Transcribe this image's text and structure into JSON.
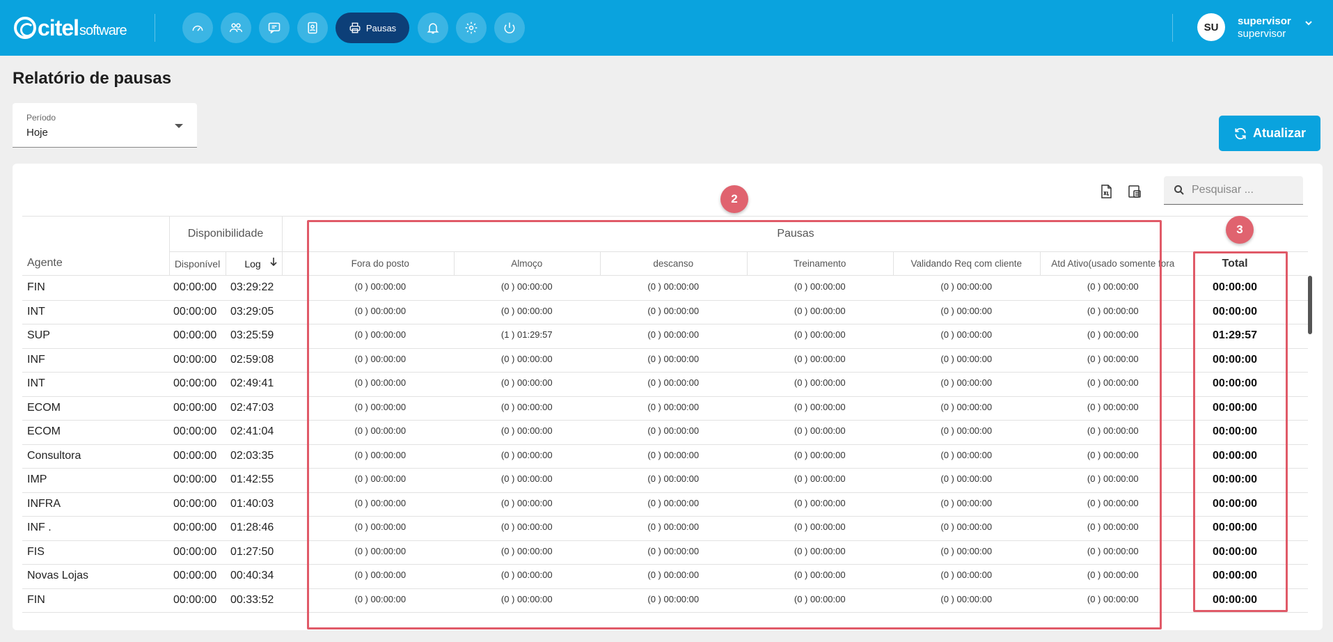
{
  "brand": {
    "name": "citel",
    "suffix": "software"
  },
  "nav": {
    "items": [
      {
        "icon": "dashboard-icon"
      },
      {
        "icon": "users-icon"
      },
      {
        "icon": "chat-icon"
      },
      {
        "icon": "contacts-icon"
      },
      {
        "icon": "printer-icon",
        "label": "Pausas",
        "active": true
      },
      {
        "icon": "bell-icon"
      },
      {
        "icon": "gear-icon"
      },
      {
        "icon": "power-icon"
      }
    ]
  },
  "user": {
    "initials": "SU",
    "name": "supervisor",
    "role": "supervisor"
  },
  "page": {
    "title": "Relatório de pausas"
  },
  "periodo": {
    "label": "Período",
    "value": "Hoje"
  },
  "refresh_label": "Atualizar",
  "search": {
    "placeholder": "Pesquisar ..."
  },
  "table": {
    "group_disponibilidade": "Disponibilidade",
    "group_pausas": "Pausas",
    "col_agente": "Agente",
    "col_disponivel": "Disponível",
    "col_log": "Log",
    "col_total": "Total",
    "pausa_columns": [
      "Fora do posto",
      "Almoço",
      "descanso",
      "Treinamento",
      "Validando Req com cliente",
      "Atd Ativo(usado somente fora"
    ],
    "rows": [
      {
        "agente": "FIN",
        "disponivel": "00:00:00",
        "log": "03:29:22",
        "pausas": [
          "(0 ) 00:00:00",
          "(0 ) 00:00:00",
          "(0 ) 00:00:00",
          "(0 ) 00:00:00",
          "(0 ) 00:00:00",
          "(0 ) 00:00:00"
        ],
        "total": "00:00:00"
      },
      {
        "agente": "INT",
        "disponivel": "00:00:00",
        "log": "03:29:05",
        "pausas": [
          "(0 ) 00:00:00",
          "(0 ) 00:00:00",
          "(0 ) 00:00:00",
          "(0 ) 00:00:00",
          "(0 ) 00:00:00",
          "(0 ) 00:00:00"
        ],
        "total": "00:00:00"
      },
      {
        "agente": "SUP",
        "disponivel": "00:00:00",
        "log": "03:25:59",
        "pausas": [
          "(0 ) 00:00:00",
          "(1 ) 01:29:57",
          "(0 ) 00:00:00",
          "(0 ) 00:00:00",
          "(0 ) 00:00:00",
          "(0 ) 00:00:00"
        ],
        "total": "01:29:57"
      },
      {
        "agente": "INF",
        "disponivel": "00:00:00",
        "log": "02:59:08",
        "pausas": [
          "(0 ) 00:00:00",
          "(0 ) 00:00:00",
          "(0 ) 00:00:00",
          "(0 ) 00:00:00",
          "(0 ) 00:00:00",
          "(0 ) 00:00:00"
        ],
        "total": "00:00:00"
      },
      {
        "agente": "INT",
        "disponivel": "00:00:00",
        "log": "02:49:41",
        "pausas": [
          "(0 ) 00:00:00",
          "(0 ) 00:00:00",
          "(0 ) 00:00:00",
          "(0 ) 00:00:00",
          "(0 ) 00:00:00",
          "(0 ) 00:00:00"
        ],
        "total": "00:00:00"
      },
      {
        "agente": " ECOM",
        "disponivel": "00:00:00",
        "log": "02:47:03",
        "pausas": [
          "(0 ) 00:00:00",
          "(0 ) 00:00:00",
          "(0 ) 00:00:00",
          "(0 ) 00:00:00",
          "(0 ) 00:00:00",
          "(0 ) 00:00:00"
        ],
        "total": "00:00:00"
      },
      {
        "agente": "ECOM",
        "disponivel": "00:00:00",
        "log": "02:41:04",
        "pausas": [
          "(0 ) 00:00:00",
          "(0 ) 00:00:00",
          "(0 ) 00:00:00",
          "(0 ) 00:00:00",
          "(0 ) 00:00:00",
          "(0 ) 00:00:00"
        ],
        "total": "00:00:00"
      },
      {
        "agente": "Consultora",
        "disponivel": "00:00:00",
        "log": "02:03:35",
        "pausas": [
          "(0 ) 00:00:00",
          "(0 ) 00:00:00",
          "(0 ) 00:00:00",
          "(0 ) 00:00:00",
          "(0 ) 00:00:00",
          "(0 ) 00:00:00"
        ],
        "total": "00:00:00"
      },
      {
        "agente": "IMP",
        "disponivel": "00:00:00",
        "log": "01:42:55",
        "pausas": [
          "(0 ) 00:00:00",
          "(0 ) 00:00:00",
          "(0 ) 00:00:00",
          "(0 ) 00:00:00",
          "(0 ) 00:00:00",
          "(0 ) 00:00:00"
        ],
        "total": "00:00:00"
      },
      {
        "agente": "INFRA",
        "disponivel": "00:00:00",
        "log": "01:40:03",
        "pausas": [
          "(0 ) 00:00:00",
          "(0 ) 00:00:00",
          "(0 ) 00:00:00",
          "(0 ) 00:00:00",
          "(0 ) 00:00:00",
          "(0 ) 00:00:00"
        ],
        "total": "00:00:00"
      },
      {
        "agente": "INF .",
        "disponivel": "00:00:00",
        "log": "01:28:46",
        "pausas": [
          "(0 ) 00:00:00",
          "(0 ) 00:00:00",
          "(0 ) 00:00:00",
          "(0 ) 00:00:00",
          "(0 ) 00:00:00",
          "(0 ) 00:00:00"
        ],
        "total": "00:00:00"
      },
      {
        "agente": "FIS",
        "disponivel": "00:00:00",
        "log": "01:27:50",
        "pausas": [
          "(0 ) 00:00:00",
          "(0 ) 00:00:00",
          "(0 ) 00:00:00",
          "(0 ) 00:00:00",
          "(0 ) 00:00:00",
          "(0 ) 00:00:00"
        ],
        "total": "00:00:00"
      },
      {
        "agente": "Novas Lojas",
        "disponivel": "00:00:00",
        "log": "00:40:34",
        "pausas": [
          "(0 ) 00:00:00",
          "(0 ) 00:00:00",
          "(0 ) 00:00:00",
          "(0 ) 00:00:00",
          "(0 ) 00:00:00",
          "(0 ) 00:00:00"
        ],
        "total": "00:00:00"
      },
      {
        "agente": "FIN",
        "disponivel": "00:00:00",
        "log": "00:33:52",
        "pausas": [
          "(0 ) 00:00:00",
          "(0 ) 00:00:00",
          "(0 ) 00:00:00",
          "(0 ) 00:00:00",
          "(0 ) 00:00:00",
          "(0 ) 00:00:00"
        ],
        "total": "00:00:00"
      }
    ]
  },
  "annotations": [
    {
      "label": "2"
    },
    {
      "label": "3"
    }
  ],
  "colors": {
    "topbar": "#0aa3de",
    "active_nav": "#0d3f78",
    "annotation": "#e05a68"
  }
}
